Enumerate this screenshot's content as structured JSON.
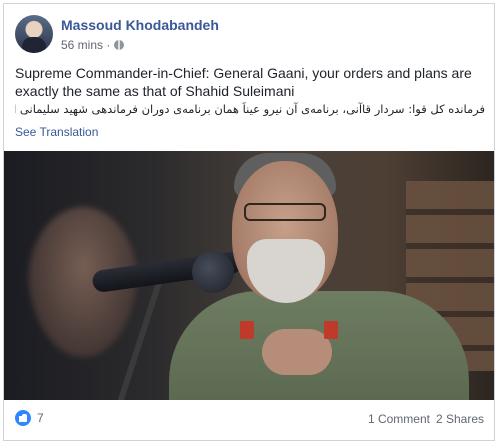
{
  "post": {
    "author": "Massoud Khodabandeh",
    "time": "56 mins ·",
    "text": "Supreme Commander-in-Chief: General Gaani, your orders and plans are exactly the same as that of Shahid Suleimani",
    "persian_text": "فرمانده کل قوا: سردار قاآنی، برنامه‌ی آن نیرو عیناً همان برنامه‌ی دوران فرماندهی شهید سلیمانی است",
    "see_translation": "See Translation",
    "reactions_count": "7",
    "comments": "1 Comment",
    "shares": "2 Shares"
  },
  "icons": {
    "audience": "globe-icon",
    "reaction": "like-icon"
  },
  "colors": {
    "link": "#385898",
    "like": "#2d88ff"
  }
}
